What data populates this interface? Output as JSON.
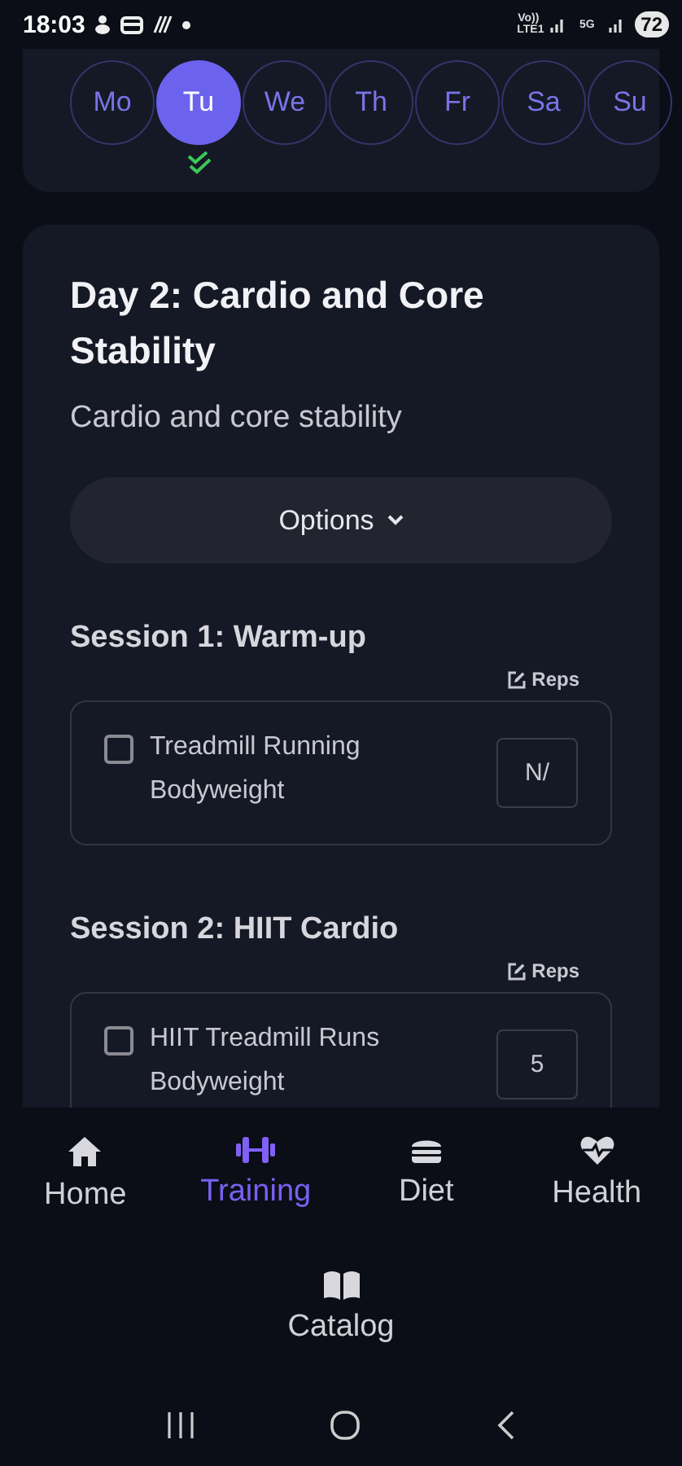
{
  "status_bar": {
    "time": "18:03",
    "network_labels": [
      "Vo)) LTE1",
      "5G"
    ],
    "battery": "72"
  },
  "days": [
    {
      "label": "Mo",
      "selected": false,
      "done": false
    },
    {
      "label": "Tu",
      "selected": true,
      "done": true
    },
    {
      "label": "We",
      "selected": false,
      "done": false
    },
    {
      "label": "Th",
      "selected": false,
      "done": false
    },
    {
      "label": "Fr",
      "selected": false,
      "done": false
    },
    {
      "label": "Sa",
      "selected": false,
      "done": false
    },
    {
      "label": "Su",
      "selected": false,
      "done": false
    }
  ],
  "workout": {
    "title": "Day 2: Cardio and Core Stability",
    "subtitle": "Cardio and core stability",
    "options_button": "Options",
    "sessions": [
      {
        "title": "Session 1: Warm-up",
        "reps_label": "Reps",
        "exercises": [
          {
            "name": "Treadmill Running",
            "detail": "Bodyweight",
            "checked": false,
            "value": "N/"
          }
        ]
      },
      {
        "title": "Session 2: HIIT Cardio",
        "reps_label": "Reps",
        "exercises": [
          {
            "name": "HIIT Treadmill Runs",
            "detail": "Bodyweight",
            "checked": false,
            "value": "5"
          }
        ]
      }
    ]
  },
  "bottom_nav": [
    {
      "label": "Home",
      "selected": false
    },
    {
      "label": "Training",
      "selected": true
    },
    {
      "label": "Diet",
      "selected": false
    },
    {
      "label": "Health",
      "selected": false
    },
    {
      "label": "Catalog",
      "selected": false
    }
  ]
}
